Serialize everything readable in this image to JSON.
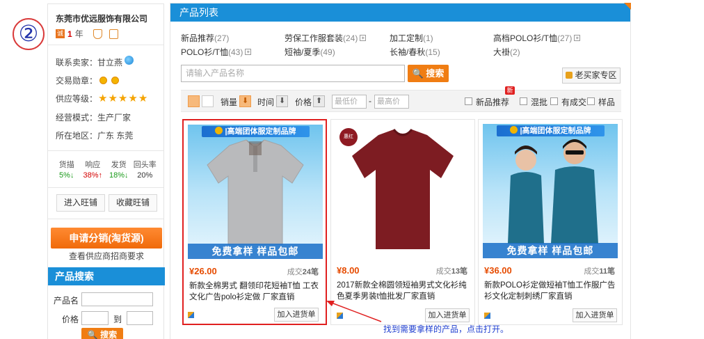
{
  "step_marker": "②",
  "sidebar": {
    "company": "东莞市优远服饰有限公司",
    "badge_cheng": "诚",
    "years_value": "1",
    "years_unit": "年",
    "contact_label": "联系卖家：",
    "contact_name": "甘立燕",
    "medal_label": "交易勋章：",
    "level_label": "供应等级：",
    "stars": [
      "★",
      "★",
      "★",
      "★",
      "★"
    ],
    "mode_label": "经营模式：",
    "mode_value": "生产厂家",
    "region_label": "所在地区：",
    "region_value": "广东 东莞",
    "stats": [
      {
        "label": "货描",
        "value": "5%↓"
      },
      {
        "label": "响应",
        "value": "38%↑"
      },
      {
        "label": "发货",
        "value": "18%↓"
      },
      {
        "label": "回头率",
        "value": "20%"
      }
    ],
    "ww_button": "进入旺铺",
    "fav_button": "收藏旺铺",
    "apply_button": "申请分销(淘货源)",
    "apply_sub": "查看供应商招商要求",
    "search": {
      "title": "产品搜索",
      "name_label": "产品名",
      "price_label": "价格",
      "to_label": "到",
      "button": "搜索",
      "search_glyph": "🔍"
    }
  },
  "main": {
    "header": "产品列表",
    "categories": [
      {
        "name": "新品推荐",
        "count": "(27)",
        "plus": false
      },
      {
        "name": "劳保工作服套装",
        "count": "(24)",
        "plus": true
      },
      {
        "name": "加工定制",
        "count": "(1)",
        "plus": false
      },
      {
        "name": "高档POLO衫/T恤",
        "count": "(27)",
        "plus": true
      },
      {
        "name": "POLO衫/T恤",
        "count": "(43)",
        "plus": true
      },
      {
        "name": "短袖/夏季",
        "count": "(49)",
        "plus": false
      },
      {
        "name": "长袖/春秋",
        "count": "(15)",
        "plus": false
      },
      {
        "name": "大褂",
        "count": "(2)",
        "plus": false
      }
    ],
    "plus_glyph": "+",
    "search_placeholder": "请输入产品名称",
    "search_button": "搜索",
    "buyer_zone": "老买家专区",
    "filter": {
      "sales": "销量",
      "time": "时间",
      "price": "价格",
      "down_arrow": "⬇",
      "up_arrow": "⬆",
      "min_price": "最低价",
      "dash": "-",
      "max_price": "最高价",
      "new_badge": "新",
      "new_products": "新品推荐",
      "mixed": "混批",
      "has_deal": "有成交",
      "samples": "样品"
    },
    "products": [
      {
        "brand_bar": "|高端团体服定制品牌",
        "free_bar": "免费拿样    样品包邮",
        "price": "¥26.00",
        "deal_prefix": "成交",
        "deal_count": "24笔",
        "title": "新款全棉男式 翻领印花短袖T恤 工衣文化广告polo衫定做 厂家直销",
        "add_button": "加入进货单",
        "shirt_color": "#b9babc"
      },
      {
        "seal": "惠红",
        "price": "¥8.00",
        "deal_prefix": "成交",
        "deal_count": "13笔",
        "title": "2017新款全棉圆领短袖男式文化衫纯色夏季男装t恤批发厂家直销",
        "add_button": "加入进货单",
        "shirt_color": "#7d1c22"
      },
      {
        "brand_bar": "|高端团体服定制品牌",
        "free_bar": "免费拿样    样品包邮",
        "price": "¥36.00",
        "deal_prefix": "成交",
        "deal_count": "11笔",
        "title": "新款POLO衫定做短袖T恤工作服广告衫文化定制刺绣厂家直销",
        "add_button": "加入进货单",
        "shirt_color": "#1f6f8b"
      }
    ]
  },
  "annotation": "找到需要拿样的产品，点击打开。",
  "colors": {
    "brand_blue": "#1a8fd8",
    "accent_orange": "#f07d13",
    "price_orange": "#e64b00",
    "highlight_red": "#e02020",
    "annotation_blue": "#1f3fd0"
  }
}
